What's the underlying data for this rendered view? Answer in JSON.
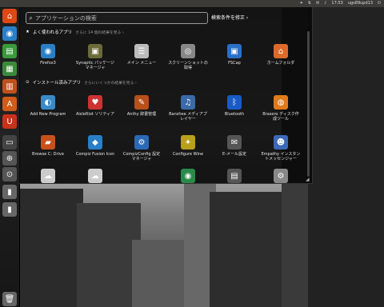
{
  "top_panel": {
    "tray_items": [
      {
        "name": "dropbox-icon",
        "glyph": "✦"
      },
      {
        "name": "network-icon",
        "glyph": "⇅"
      },
      {
        "name": "mail-icon",
        "glyph": "✉"
      },
      {
        "name": "volume-icon",
        "glyph": "♪"
      }
    ],
    "clock": "17:53",
    "user": "ugs89upd13",
    "power_glyph": "⏻"
  },
  "launcher": {
    "items": [
      {
        "name": "launcher-home-folder",
        "glyph": "⌂",
        "color": "#dd4814"
      },
      {
        "name": "launcher-firefox",
        "glyph": "◉",
        "color": "#2a7fc7"
      },
      {
        "name": "launcher-writer",
        "glyph": "▤",
        "color": "#3a9a3a"
      },
      {
        "name": "launcher-calc",
        "glyph": "▦",
        "color": "#3a8a3a"
      },
      {
        "name": "launcher-impress",
        "glyph": "▥",
        "color": "#c0501a"
      },
      {
        "name": "launcher-software-center",
        "glyph": "A",
        "color": "#d05b1a"
      },
      {
        "name": "launcher-ubuntu-one",
        "glyph": "U",
        "color": "#c8321a"
      },
      {
        "name": "launcher-workspace",
        "glyph": "▭",
        "color": "#444"
      },
      {
        "name": "launcher-apps-lens",
        "glyph": "⊕",
        "color": "#555"
      },
      {
        "name": "launcher-files-lens",
        "glyph": "⊙",
        "color": "#555"
      },
      {
        "name": "launcher-usb",
        "glyph": "▮",
        "color": "#666"
      },
      {
        "name": "launcher-usb2",
        "glyph": "▮",
        "color": "#666"
      },
      {
        "name": "launcher-trash",
        "glyph": "🗑",
        "color": "#666"
      }
    ]
  },
  "dash": {
    "search_placeholder": "アプリケーションの検索",
    "filter_label": "検索条件を修正 ›",
    "frequent": {
      "title": "よく使われるアプリ",
      "more": "さらに 14 個の結果を見る ›",
      "apps": [
        {
          "name": "app-firefox",
          "label": "Firefox3",
          "glyph": "◉",
          "color": "#2a7fc7"
        },
        {
          "name": "app-synaptic",
          "label": "Synaptic パッケージマネージャ",
          "glyph": "▣",
          "color": "#6a6a3a"
        },
        {
          "name": "app-main-menu",
          "label": "メイン メニュー",
          "glyph": "☰",
          "color": "#bbb"
        },
        {
          "name": "app-screenshot",
          "label": "スクリーンショットの取得",
          "glyph": "◎",
          "color": "#888"
        },
        {
          "name": "app-fscap",
          "label": "FSCap",
          "glyph": "▣",
          "color": "#2a6fc7"
        },
        {
          "name": "app-home-folder",
          "label": "ホームフォルダ",
          "glyph": "⌂",
          "color": "#dd6a2a"
        }
      ]
    },
    "installed": {
      "title": "インストール済みアプリ",
      "more": "さらにいくつかの結果を見る ›",
      "rows": [
        [
          {
            "name": "app-add-new-program",
            "label": "Add New Program",
            "glyph": "◐",
            "color": "#3a8ac7"
          },
          {
            "name": "app-aisleriot",
            "label": "AisleRiot ソリティア",
            "glyph": "♥",
            "color": "#c33"
          },
          {
            "name": "app-anthy-dictionary",
            "label": "Anthy 辞書管理",
            "glyph": "✎",
            "color": "#b8501a"
          },
          {
            "name": "app-banshee",
            "label": "Banshee メディアプレイヤー",
            "glyph": "♫",
            "color": "#3a6aa7"
          },
          {
            "name": "app-bluetooth",
            "label": "Bluetooth",
            "glyph": "ᛒ",
            "color": "#1a5ac7"
          },
          {
            "name": "app-brasero",
            "label": "Brasero ディスク作成ツール",
            "glyph": "◍",
            "color": "#e07a1a"
          }
        ],
        [
          {
            "name": "app-browse-c-drive",
            "label": "Browse C: Drive",
            "glyph": "▰",
            "color": "#c8501a"
          },
          {
            "name": "app-compiz-fusion-icon",
            "label": "Compiz Fusion Icon",
            "glyph": "◆",
            "color": "#2a7fc7"
          },
          {
            "name": "app-compizconfig",
            "label": "CompizConfig 設定マネージャ",
            "glyph": "⚙",
            "color": "#2a6ab7"
          },
          {
            "name": "app-configure-wine",
            "label": "Configure Wine",
            "glyph": "✦",
            "color": "#b8a01a"
          },
          {
            "name": "app-email-settings",
            "label": "E-メール設定",
            "glyph": "✉",
            "color": "#555"
          },
          {
            "name": "app-empathy",
            "label": "Empathy インスタントメッセンジャー",
            "glyph": "☻",
            "color": "#3a6ab7"
          }
        ],
        [
          {
            "name": "app-row3-1",
            "label": "",
            "glyph": "☁",
            "color": "#ccc"
          },
          {
            "name": "app-row3-2",
            "label": "",
            "glyph": "☁",
            "color": "#ccc"
          },
          {
            "name": "app-row3-3",
            "label": "",
            "glyph": "",
            "color": "transparent"
          },
          {
            "name": "app-row3-4",
            "label": "",
            "glyph": "◉",
            "color": "#2a8a4a"
          },
          {
            "name": "app-row3-5",
            "label": "",
            "glyph": "▤",
            "color": "#555"
          },
          {
            "name": "app-row3-6",
            "label": "",
            "glyph": "⚙",
            "color": "#888"
          }
        ]
      ]
    }
  }
}
